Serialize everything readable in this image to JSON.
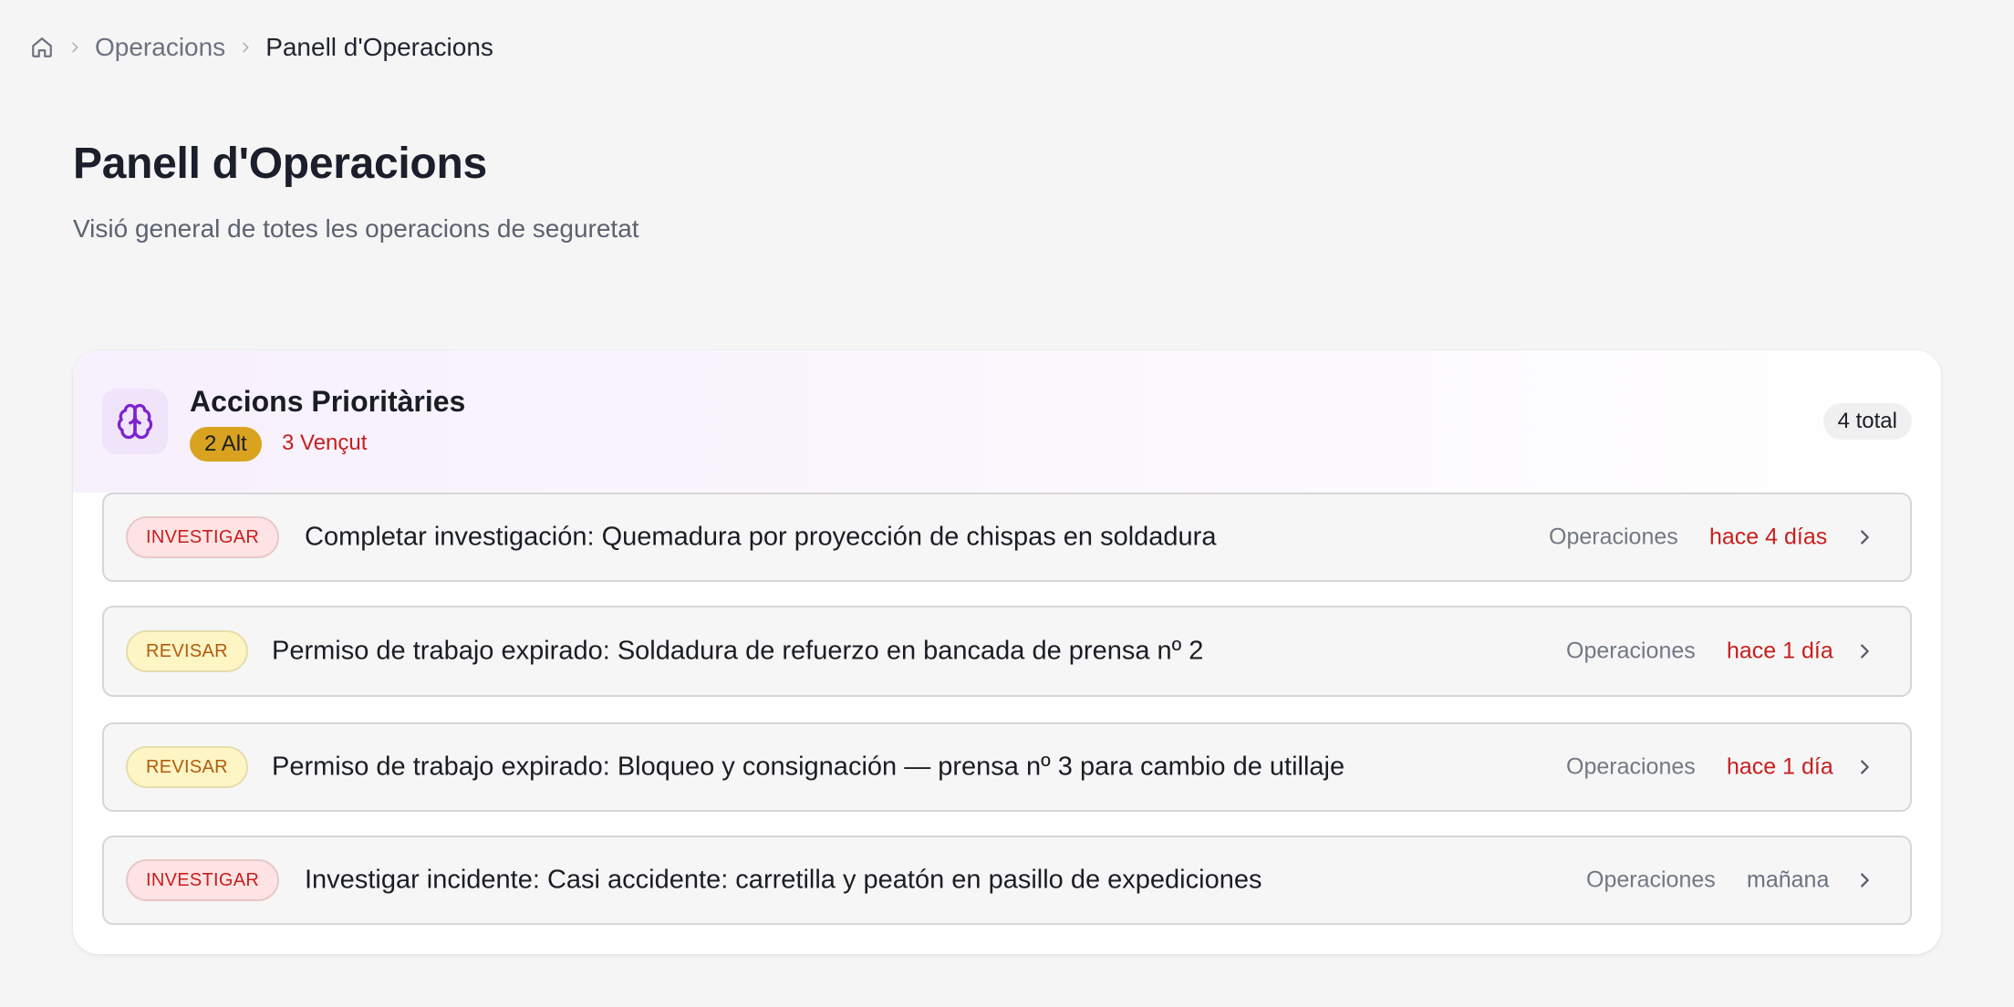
{
  "breadcrumb": {
    "home_icon": "home-icon",
    "items": [
      "Operacions",
      "Panell d'Operacions"
    ]
  },
  "page": {
    "title": "Panell d'Operacions",
    "subtitle": "Visió general de totes les operacions de seguretat"
  },
  "card": {
    "icon": "brain-icon",
    "title": "Accions Prioritàries",
    "alt_badge": "2 Alt",
    "overdue": "3 Vençut",
    "total": "4 total",
    "rows": [
      {
        "tag": "INVESTIGAR",
        "text": "Completar investigación: Quemadura por proyección de chispas en soldadura",
        "dept": "Operaciones",
        "date": "hace 4 días"
      },
      {
        "tag": "REVISAR",
        "text": "Permiso de trabajo expirado: Soldadura de refuerzo en bancada de prensa nº 2",
        "dept": "Operaciones",
        "date": "hace 1 día"
      },
      {
        "tag": "REVISAR",
        "text": "Permiso de trabajo expirado: Bloqueo y consignación — prensa nº 3 para cambio de utillaje",
        "dept": "Operaciones",
        "date": "hace 1 día"
      },
      {
        "tag": "INVESTIGAR",
        "text": "Investigar incidente: Casi accidente: carretilla y peatón en pasillo de expediciones",
        "dept": "Operaciones",
        "date": "mañana"
      }
    ]
  },
  "colors": {
    "accent_purple": "#7e22ce",
    "alt_badge": "#d9a320",
    "overdue_red": "#c81e1e"
  }
}
